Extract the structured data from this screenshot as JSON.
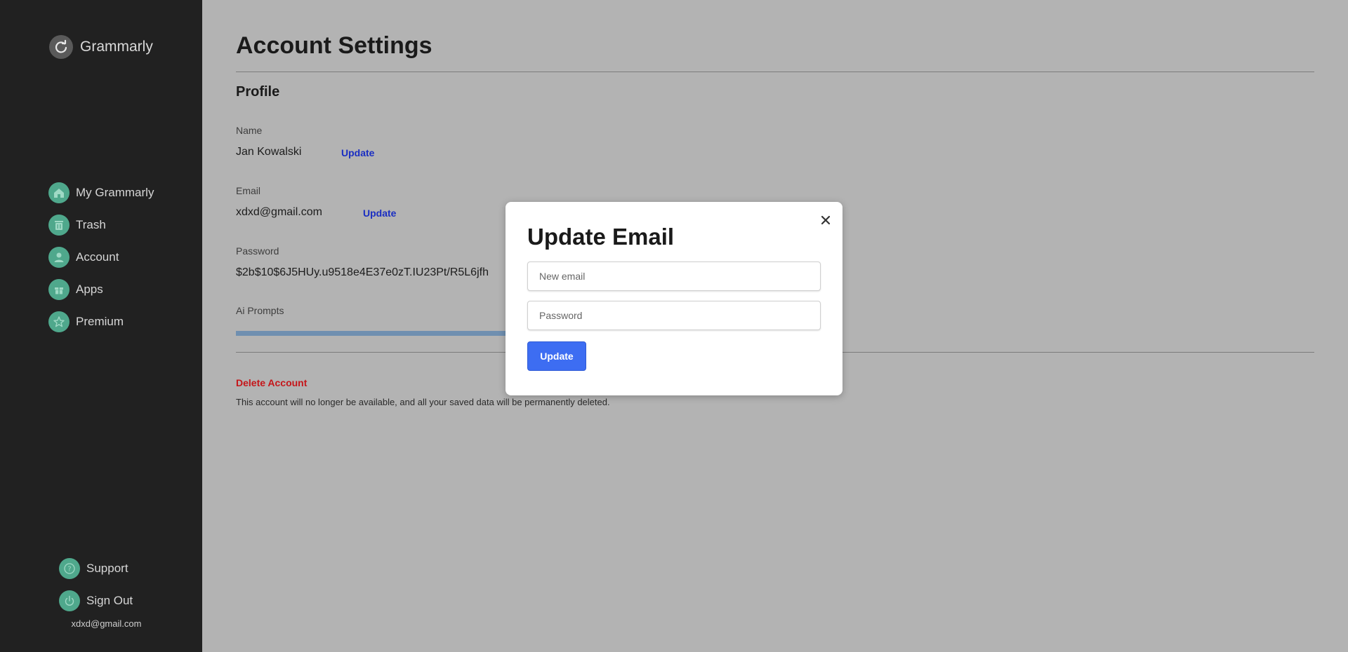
{
  "sidebar": {
    "brand": {
      "name": "Grammarly",
      "icon": "grammarly-logo-icon"
    },
    "nav": [
      {
        "label": "My Grammarly",
        "icon": "home-icon"
      },
      {
        "label": "Trash",
        "icon": "trash-icon"
      },
      {
        "label": "Account",
        "icon": "user-icon"
      },
      {
        "label": "Apps",
        "icon": "gift-icon"
      },
      {
        "label": "Premium",
        "icon": "star-icon"
      }
    ],
    "bottom": [
      {
        "label": "Support",
        "icon": "help-icon"
      },
      {
        "label": "Sign Out",
        "icon": "power-icon"
      }
    ],
    "user_email": "xdxd@gmail.com"
  },
  "main": {
    "title": "Account Settings",
    "profile_heading": "Profile",
    "name": {
      "label": "Name",
      "value": "Jan Kowalski",
      "action": "Update"
    },
    "email": {
      "label": "Email",
      "value": "xdxd@gmail.com",
      "action": "Update"
    },
    "password": {
      "label": "Password",
      "value": "$2b$10$6J5HUy.u9518e4E37e0zT.IU23Pt/R5L6jfh"
    },
    "ai_prompts": {
      "label": "Ai Prompts",
      "progress": 0.5
    },
    "delete": {
      "title": "Delete Account",
      "description": "This account will no longer be available, and all your saved data will be permanently deleted."
    }
  },
  "modal": {
    "title": "Update Email",
    "close_icon": "close-icon",
    "new_email_placeholder": "New email",
    "new_email_value": "",
    "password_placeholder": "Password",
    "password_value": "",
    "submit_label": "Update"
  },
  "colors": {
    "sidebar_bg": "#212121",
    "overlay_bg": "#b3b3b3",
    "icon_accent": "#4fa88c",
    "link": "#1a2ec2",
    "danger": "#c5161a",
    "primary_button": "#3d6df2"
  }
}
